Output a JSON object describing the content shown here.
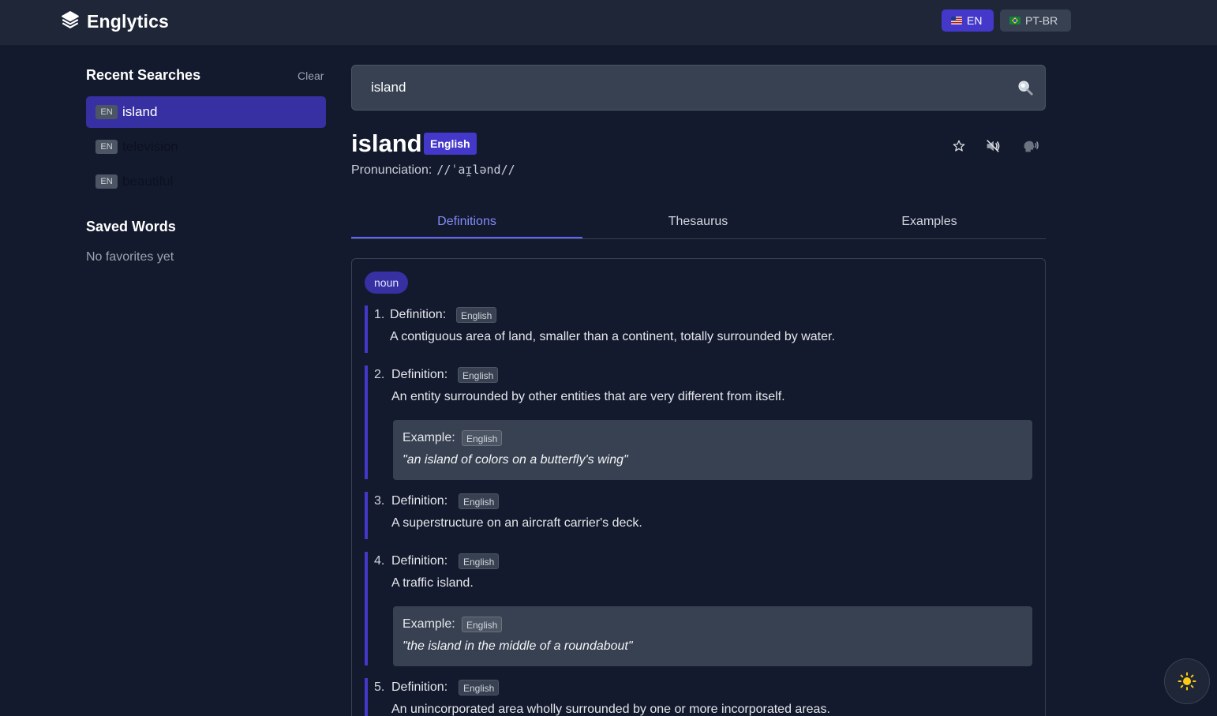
{
  "header": {
    "app_name": "Englytics",
    "languages": [
      {
        "label": "EN",
        "active": true
      },
      {
        "label": "PT-BR",
        "active": false
      }
    ]
  },
  "sidebar": {
    "recent_title": "Recent Searches",
    "clear_label": "Clear",
    "recent": [
      {
        "lang": "EN",
        "word": "island",
        "active": true
      },
      {
        "lang": "EN",
        "word": "television",
        "active": false
      },
      {
        "lang": "EN",
        "word": "beautiful",
        "active": false
      }
    ],
    "saved_title": "Saved Words",
    "saved_empty": "No favorites yet"
  },
  "search": {
    "value": "island",
    "placeholder": ""
  },
  "entry": {
    "word": "island",
    "language": "English",
    "pronunciation_label": "Pronunciation:",
    "pronunciation": "//ˈaɪ̯lənd//",
    "part_of_speech": "noun"
  },
  "tabs": [
    "Definitions",
    "Thesaurus",
    "Examples"
  ],
  "active_tab": "Definitions",
  "labels": {
    "definition": "Definition:",
    "example": "Example:",
    "lang_tag": "English"
  },
  "definitions": [
    {
      "num": "1.",
      "text": "A contiguous area of land, smaller than a continent, totally surrounded by water.",
      "example": null
    },
    {
      "num": "2.",
      "text": "An entity surrounded by other entities that are very different from itself.",
      "example": "\"an island of colors on a butterfly's wing\""
    },
    {
      "num": "3.",
      "text": "A superstructure on an aircraft carrier's deck.",
      "example": null
    },
    {
      "num": "4.",
      "text": "A traffic island.",
      "example": "\"the island in the middle of a roundabout\""
    },
    {
      "num": "5.",
      "text": "An unincorporated area wholly surrounded by one or more incorporated areas.",
      "example": null
    }
  ],
  "colors": {
    "accent": "#4338ca",
    "background": "#141a2e",
    "header": "#1e2637"
  },
  "icons": {
    "logo": "layers-icon",
    "search": "magnifier-icon",
    "favorite": "star-icon",
    "audio": "speaker-icon",
    "speak": "talking-head-icon",
    "theme": "sun-icon"
  }
}
